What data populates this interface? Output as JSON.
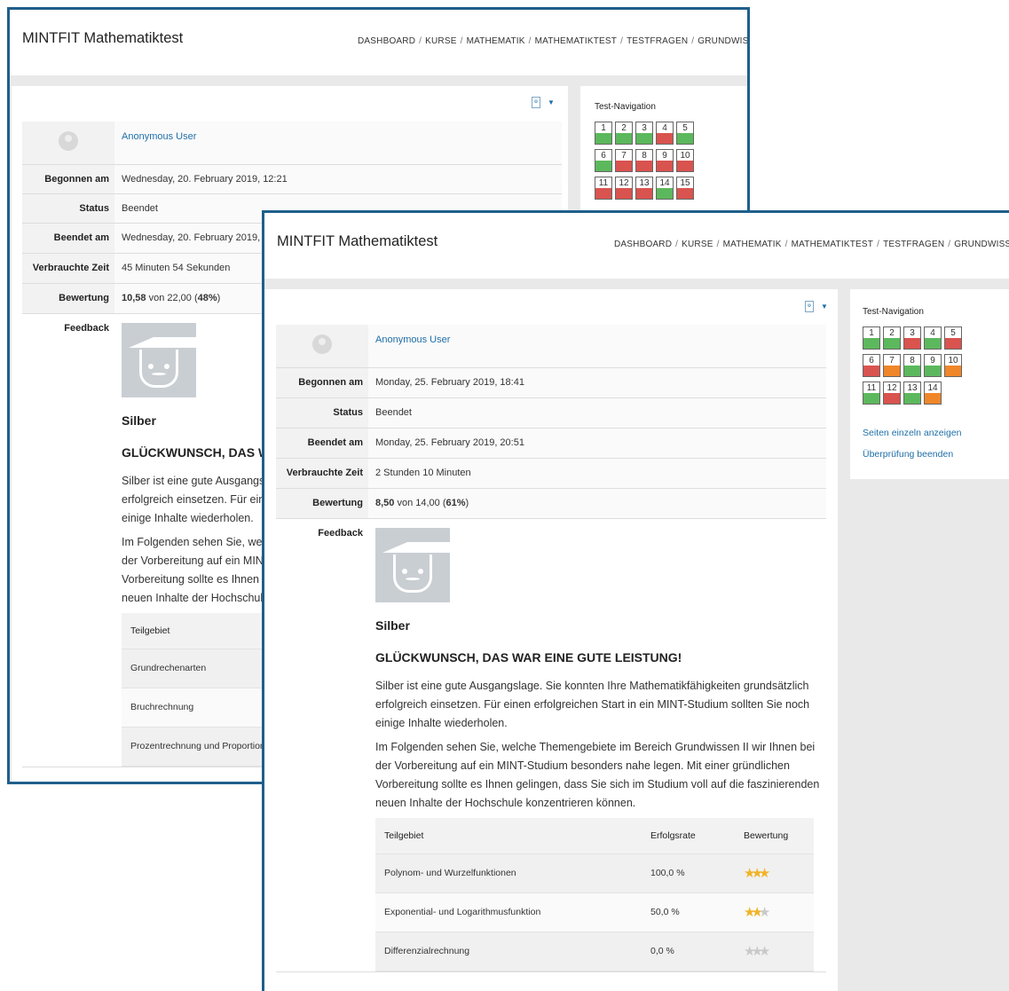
{
  "colors": {
    "frame_border": "#1f5f8b",
    "link": "#1f6fa8",
    "correct": "#5cb85c",
    "wrong": "#d9534f",
    "partial": "#f0862a",
    "star": "#f0b429"
  },
  "back": {
    "site_title": "MINTFIT Mathematiktest",
    "breadcrumb": [
      "DASHBOARD",
      "KURSE",
      "MATHEMATIK",
      "MATHEMATIKTEST",
      "TESTFRAGEN",
      "GRUNDWISSEN I"
    ],
    "summary": {
      "user": "Anonymous User",
      "started_label": "Begonnen am",
      "started": "Wednesday, 20. February 2019, 12:21",
      "status_label": "Status",
      "status": "Beendet",
      "completed_label": "Beendet am",
      "completed": "Wednesday, 20. February 2019, 13",
      "time_label": "Verbrauchte Zeit",
      "time": "45 Minuten 54 Sekunden",
      "grade_label": "Bewertung",
      "grade_score": "10,58",
      "grade_mid": " von 22,00 (",
      "grade_percent": "48%",
      "grade_end": ")",
      "feedback_label": "Feedback"
    },
    "feedback": {
      "level": "Silber",
      "heading": "GLÜCKWUNSCH, DAS WA",
      "p1_l1": "Silber ist eine gute Ausgangs",
      "p1_l2": "erfolgreich einsetzen. Für ein",
      "p1_l3": "einige Inhalte wiederholen.",
      "p2_l1": "Im Folgenden sehen Sie, welc",
      "p2_l2": "der Vorbereitung auf ein MINT",
      "p2_l3": "Vorbereitung sollte es Ihnen g",
      "p2_l4": "neuen Inhalte der Hochschule"
    },
    "topics_header": "Teilgebiet",
    "topics": [
      "Grundrechenarten",
      "Bruchrechnung",
      "Prozentrechnung und Proportion"
    ],
    "nav_title": "Test-Navigation",
    "questions": [
      {
        "n": "1",
        "s": "correct"
      },
      {
        "n": "2",
        "s": "correct"
      },
      {
        "n": "3",
        "s": "correct"
      },
      {
        "n": "4",
        "s": "wrong"
      },
      {
        "n": "5",
        "s": "correct"
      },
      {
        "n": "6",
        "s": "correct"
      },
      {
        "n": "7",
        "s": "wrong"
      },
      {
        "n": "8",
        "s": "wrong"
      },
      {
        "n": "9",
        "s": "wrong"
      },
      {
        "n": "10",
        "s": "wrong"
      },
      {
        "n": "11",
        "s": "wrong"
      },
      {
        "n": "12",
        "s": "wrong"
      },
      {
        "n": "13",
        "s": "wrong"
      },
      {
        "n": "14",
        "s": "correct"
      },
      {
        "n": "15",
        "s": "wrong"
      }
    ]
  },
  "front": {
    "site_title": "MINTFIT Mathematiktest",
    "breadcrumb": [
      "DASHBOARD",
      "KURSE",
      "MATHEMATIK",
      "MATHEMATIKTEST",
      "TESTFRAGEN",
      "GRUNDWISSEN II"
    ],
    "summary": {
      "user": "Anonymous User",
      "started_label": "Begonnen am",
      "started": "Monday, 25. February 2019, 18:41",
      "status_label": "Status",
      "status": "Beendet",
      "completed_label": "Beendet am",
      "completed": "Monday, 25. February 2019, 20:51",
      "time_label": "Verbrauchte Zeit",
      "time": "2 Stunden 10 Minuten",
      "grade_label": "Bewertung",
      "grade_score": "8,50",
      "grade_mid": " von 14,00 (",
      "grade_percent": "61%",
      "grade_end": ")",
      "feedback_label": "Feedback"
    },
    "feedback": {
      "level": "Silber",
      "heading": "GLÜCKWUNSCH, DAS WAR EINE GUTE LEISTUNG!",
      "p1_l1": "Silber ist eine gute Ausgangslage. Sie konnten Ihre Mathematikfähigkeiten grundsätzlich",
      "p1_l2": "erfolgreich einsetzen. Für einen erfolgreichen Start in ein MINT-Studium sollten Sie noch",
      "p1_l3": "einige Inhalte wiederholen.",
      "p2_l1": "Im Folgenden sehen Sie, welche Themengebiete im Bereich Grundwissen II wir Ihnen bei",
      "p2_l2": "der Vorbereitung auf ein MINT-Studium besonders nahe legen. Mit einer gründlichen",
      "p2_l3": "Vorbereitung sollte es Ihnen gelingen, dass Sie sich im Studium voll auf die faszinierenden",
      "p2_l4": "neuen Inhalte der Hochschule konzentrieren können."
    },
    "topics_headers": {
      "area": "Teilgebiet",
      "rate": "Erfolgsrate",
      "rating": "Bewertung"
    },
    "topics": [
      {
        "name": "Polynom- und Wurzelfunktionen",
        "rate": "100,0 %",
        "stars": 3
      },
      {
        "name": "Exponential- und Logarithmusfunktion",
        "rate": "50,0 %",
        "stars": 2
      },
      {
        "name": "Differenzialrechnung",
        "rate": "0,0 %",
        "stars": 0
      }
    ],
    "nav_title": "Test-Navigation",
    "questions": [
      {
        "n": "1",
        "s": "correct"
      },
      {
        "n": "2",
        "s": "correct"
      },
      {
        "n": "3",
        "s": "wrong"
      },
      {
        "n": "4",
        "s": "correct"
      },
      {
        "n": "5",
        "s": "wrong"
      },
      {
        "n": "6",
        "s": "wrong"
      },
      {
        "n": "7",
        "s": "partial"
      },
      {
        "n": "8",
        "s": "correct"
      },
      {
        "n": "9",
        "s": "correct"
      },
      {
        "n": "10",
        "s": "partial"
      },
      {
        "n": "11",
        "s": "correct"
      },
      {
        "n": "12",
        "s": "wrong"
      },
      {
        "n": "13",
        "s": "correct"
      },
      {
        "n": "14",
        "s": "partial"
      }
    ],
    "show_one_page": "Seiten einzeln anzeigen",
    "finish_review": "Überprüfung beenden"
  }
}
